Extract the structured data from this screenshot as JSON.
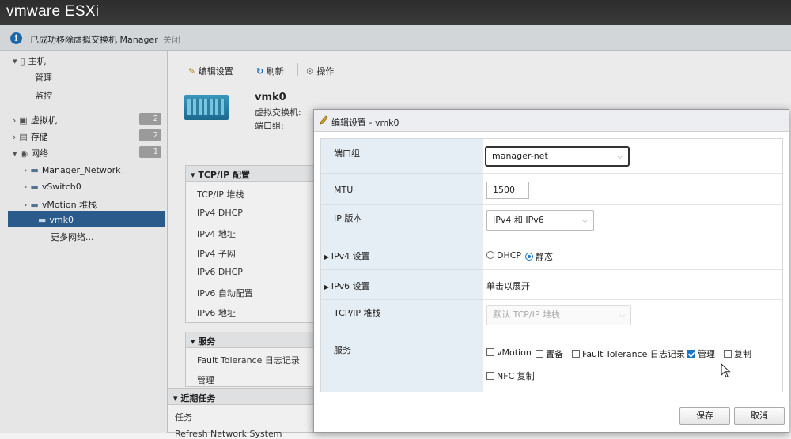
{
  "app": {
    "brand": "vmware ESXi"
  },
  "notification": {
    "message": "已成功移除虚拟交换机 Manager",
    "close": "关闭"
  },
  "sidebar": {
    "host": "主机",
    "manage": "管理",
    "monitor": "监控",
    "vms": {
      "label": "虚拟机",
      "count": "2"
    },
    "storage": {
      "label": "存储",
      "count": "2"
    },
    "networking": {
      "label": "网络",
      "count": "1"
    },
    "net_items": [
      "Manager_Network",
      "vSwitch0",
      "vMotion 堆栈",
      "vmk0"
    ],
    "more": "更多网络..."
  },
  "toolbar": {
    "edit": "编辑设置",
    "refresh": "刷新",
    "actions": "操作"
  },
  "vmk": {
    "name": "vmk0",
    "type_label": "虚拟交换机:",
    "portgroup_label": "端口组:"
  },
  "tcpip_panel": {
    "title": "TCP/IP 配置",
    "rows": [
      "TCP/IP 堆栈",
      "IPv4 DHCP",
      "IPv4 地址",
      "IPv4 子网",
      "IPv6 DHCP",
      "IPv6 自动配置",
      "IPv6 地址"
    ]
  },
  "services_panel": {
    "title": "服务",
    "rows": [
      "Fault Tolerance 日志记录",
      "管理"
    ]
  },
  "tasks_panel": {
    "title": "近期任务",
    "col": "任务",
    "row": "Refresh Network System"
  },
  "dialog": {
    "title": "编辑设置 - vmk0",
    "portgroup": {
      "label": "端口组",
      "value": "manager-net"
    },
    "mtu": {
      "label": "MTU",
      "value": "1500"
    },
    "ipversion": {
      "label": "IP 版本",
      "value": "IPv4 和 IPv6"
    },
    "ipv4": {
      "label": "IPv4 设置",
      "dhcp": "DHCP",
      "static": "静态",
      "selected": "static"
    },
    "ipv6": {
      "label": "IPv6 设置",
      "value": "单击以展开"
    },
    "stack": {
      "label": "TCP/IP 堆栈",
      "value": "默认 TCP/IP 堆栈"
    },
    "services": {
      "label": "服务",
      "items": [
        {
          "name": "vMotion",
          "checked": false
        },
        {
          "name": "置备",
          "checked": false
        },
        {
          "name": "Fault Tolerance 日志记录",
          "checked": false
        },
        {
          "name": "管理",
          "checked": true
        },
        {
          "name": "复制",
          "checked": false
        },
        {
          "name": "NFC 复制",
          "checked": false
        }
      ]
    },
    "save": "保存",
    "cancel": "取消"
  },
  "colors": {
    "accent": "#1976c9",
    "selected_nav": "#2b5f93",
    "label_bg": "#e6eef5"
  }
}
